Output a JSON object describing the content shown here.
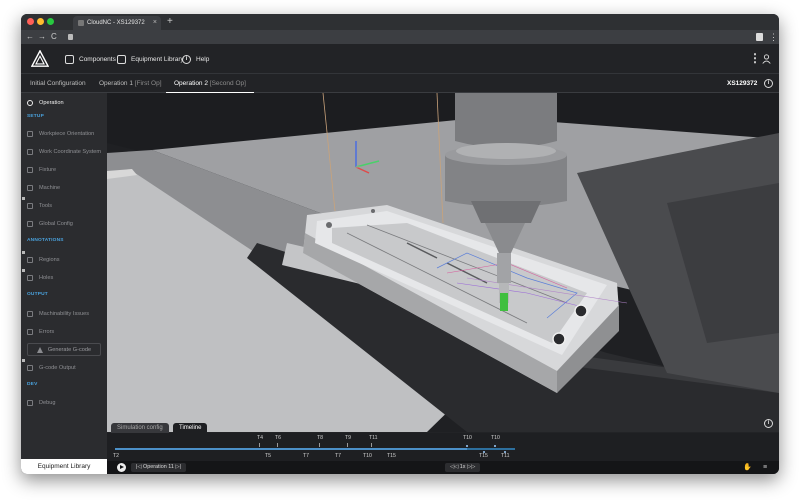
{
  "browser": {
    "tab_title": "CloudNC - XS129372",
    "tab_close": "×",
    "new_tab": "+",
    "nav_back": "←",
    "nav_forward": "→",
    "nav_reload": "C",
    "menu": "⋮",
    "colors": {
      "close": "#ff5f57",
      "minimize": "#febc2e",
      "maximize": "#28c840"
    }
  },
  "header": {
    "nav": [
      {
        "label": "Components",
        "icon": "components-icon"
      },
      {
        "label": "Equipment Library",
        "icon": "layers-icon"
      },
      {
        "label": "Help",
        "icon": "help-icon"
      }
    ],
    "help_glyph": "i",
    "more": "⋮"
  },
  "ops_tabs": [
    {
      "label": "Initial Configuration",
      "sub": ""
    },
    {
      "label": "Operation 1",
      "sub": "[First Op]"
    },
    {
      "label": "Operation 2",
      "sub": "[Second Op]",
      "active": true
    }
  ],
  "part_id": "XS129372",
  "info_glyph": "i",
  "sidebar": {
    "operation": "Operation",
    "sections": {
      "setup": "SETUP",
      "annotations": "ANNOTATIONS",
      "output": "OUTPUT",
      "dev": "DEV"
    },
    "setup_items": [
      "Workpiece Orientation",
      "Work Coordinate System",
      "Fixture",
      "Machine",
      "Tools",
      "Global Config"
    ],
    "annotation_items": [
      "Regions",
      "Holes"
    ],
    "output_items": [
      "Machinability Issues",
      "Errors"
    ],
    "generate_button": "Generate G-code",
    "gcode_output": "G-code Output",
    "dev_items": [
      "Debug"
    ],
    "footer": "Equipment Library"
  },
  "panel_tabs": [
    "Simulation config",
    "Timeline"
  ],
  "timeline": {
    "labels_top": [
      "T4",
      "T6",
      "T8",
      "T9",
      "T11",
      "T10",
      "T10"
    ],
    "labels_bottom": [
      "T2",
      "T5",
      "T7",
      "T7",
      "T10",
      "T15",
      "T15",
      "T11"
    ],
    "track_color": "#4c90c8"
  },
  "controls": {
    "prev": "|◁",
    "operation": "Operation 11",
    "next": "▷|",
    "slower": "◁◁",
    "speed": "1x",
    "faster": "▷▷",
    "cursor_tool": "✋",
    "menu": "≡"
  }
}
